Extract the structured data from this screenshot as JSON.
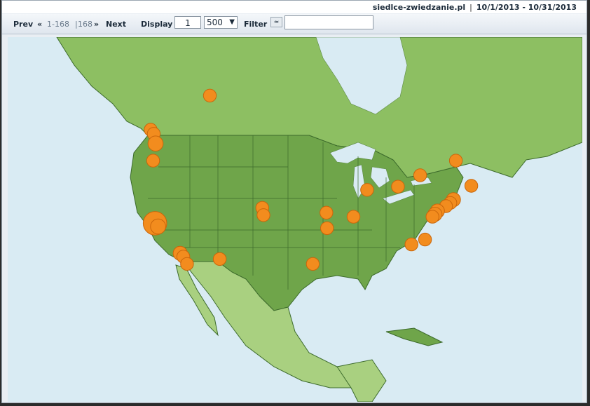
{
  "header": {
    "site": "siedlce-zwiedzanie.pl",
    "separator": "|",
    "date_range": "10/1/2013 - 10/31/2013"
  },
  "toolbar": {
    "prev_label": "Prev",
    "prev_arrows": "«",
    "range_label": "1-168",
    "pipe": "|",
    "total_label": "168",
    "next_arrows": "»",
    "next_label": "Next",
    "display_label": "Display",
    "page_value": "1",
    "per_page_value": "500",
    "per_page_chevron": "▼",
    "filter_label": "Filter",
    "filter_button_glyph": "≈",
    "filter_value": ""
  },
  "map": {
    "region": "North America",
    "colors": {
      "ocean": "#d9ebf3",
      "usa": "#6fa54a",
      "canada": "#8dbf62",
      "mexico": "#a9d080",
      "marker": "#f28c1e",
      "marker_edge": "#c9660b",
      "borders": "#3d6b2c"
    },
    "markers": [
      {
        "lon": -113.5,
        "lat": 53.5,
        "visits": 1
      },
      {
        "lon": -123.1,
        "lat": 49.3,
        "visits": 1
      },
      {
        "lon": -122.6,
        "lat": 48.8,
        "visits": 1
      },
      {
        "lon": -122.3,
        "lat": 47.6,
        "visits": 3
      },
      {
        "lon": -122.7,
        "lat": 45.5,
        "visits": 1
      },
      {
        "lon": -122.4,
        "lat": 37.8,
        "visits": 20
      },
      {
        "lon": -121.9,
        "lat": 37.4,
        "visits": 3
      },
      {
        "lon": -118.3,
        "lat": 34.1,
        "visits": 2
      },
      {
        "lon": -117.8,
        "lat": 33.7,
        "visits": 1
      },
      {
        "lon": -117.2,
        "lat": 32.8,
        "visits": 1
      },
      {
        "lon": -111.9,
        "lat": 33.4,
        "visits": 1
      },
      {
        "lon": -105.0,
        "lat": 39.7,
        "visits": 1
      },
      {
        "lon": -104.8,
        "lat": 38.8,
        "visits": 1
      },
      {
        "lon": -96.8,
        "lat": 32.8,
        "visits": 1
      },
      {
        "lon": -94.6,
        "lat": 39.1,
        "visits": 1
      },
      {
        "lon": -94.5,
        "lat": 37.2,
        "visits": 1
      },
      {
        "lon": -90.2,
        "lat": 38.6,
        "visits": 1
      },
      {
        "lon": -88.0,
        "lat": 41.9,
        "visits": 1
      },
      {
        "lon": -83.0,
        "lat": 42.3,
        "visits": 1
      },
      {
        "lon": -79.4,
        "lat": 43.7,
        "visits": 1
      },
      {
        "lon": -73.6,
        "lat": 45.5,
        "visits": 1
      },
      {
        "lon": -71.1,
        "lat": 42.4,
        "visits": 1
      },
      {
        "lon": -74.0,
        "lat": 40.7,
        "visits": 2
      },
      {
        "lon": -74.5,
        "lat": 40.3,
        "visits": 1
      },
      {
        "lon": -75.2,
        "lat": 39.9,
        "visits": 1
      },
      {
        "lon": -76.6,
        "lat": 39.3,
        "visits": 2
      },
      {
        "lon": -77.0,
        "lat": 38.9,
        "visits": 2
      },
      {
        "lon": -77.4,
        "lat": 38.6,
        "visits": 1
      },
      {
        "lon": -78.6,
        "lat": 35.8,
        "visits": 1
      },
      {
        "lon": -80.8,
        "lat": 35.2,
        "visits": 1
      }
    ]
  }
}
